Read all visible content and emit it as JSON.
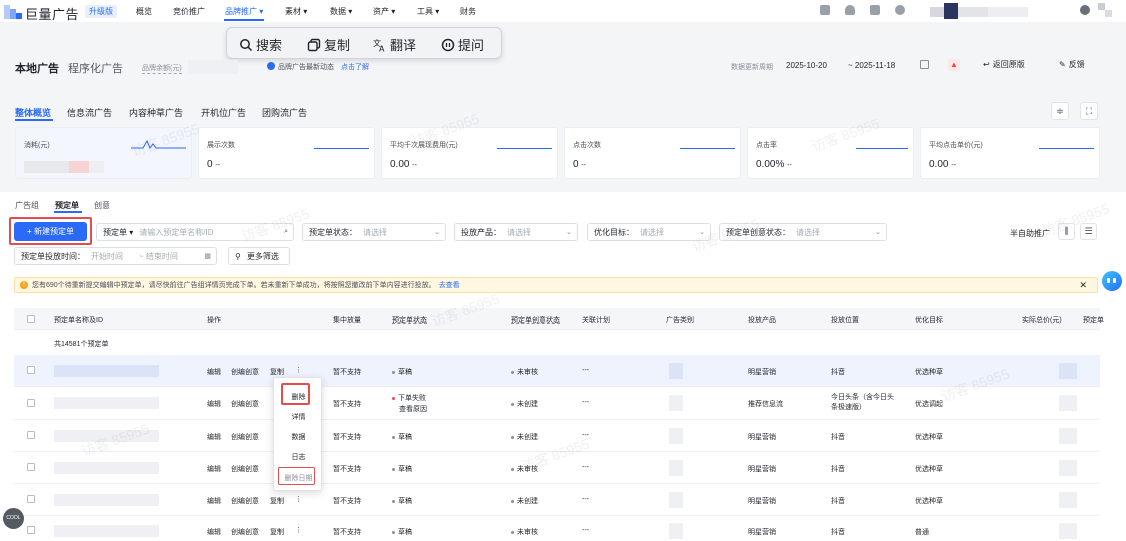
{
  "topnav": {
    "logo": "巨量广告",
    "upgrade": "升级版",
    "items": [
      "概览",
      "竞价推广",
      "品牌推广",
      "素材",
      "数据",
      "资产",
      "工具",
      "财务"
    ]
  },
  "floatbar": {
    "search": "搜索",
    "copy": "复制",
    "translate": "翻译",
    "ask": "提问"
  },
  "header": {
    "title": "本地广告",
    "subtitle": "程序化广告",
    "balance_label": "品牌余额(元)",
    "news": "品牌广告最新动态",
    "news_link": "点击了解",
    "update_label": "数据更新周期",
    "date_start": "2025-10-20",
    "date_end": "~ 2025-11-18",
    "back_label": "返回原版",
    "feedback_label": "反馈"
  },
  "tabs": [
    "整体概览",
    "信息流广告",
    "内容种草广告",
    "开机位广告",
    "团购流广告"
  ],
  "metrics": [
    {
      "label": "消耗(元)",
      "value": ""
    },
    {
      "label": "展示次数",
      "value": "0",
      "suffix": "--"
    },
    {
      "label": "平均千次展现费用(元)",
      "value": "0.00",
      "suffix": "--"
    },
    {
      "label": "点击次数",
      "value": "0",
      "suffix": "--"
    },
    {
      "label": "点击率",
      "value": "0.00%",
      "suffix": "--"
    },
    {
      "label": "平均点击单价(元)",
      "value": "0.00",
      "suffix": "--"
    }
  ],
  "subtabs": [
    "广告组",
    "预定单",
    "创意"
  ],
  "filters": {
    "new_button": "+ 新建预定单",
    "order_select": "预定单",
    "order_placeholder": "请输入预定单名称/ID",
    "status_label": "预定单状态：",
    "status_placeholder": "请选择",
    "product_label": "投放产品：",
    "product_placeholder": "请选择",
    "goal_label": "优化目标：",
    "goal_placeholder": "请选择",
    "creative_status_label": "预定单创意状态：",
    "creative_status_placeholder": "请选择",
    "semi_auto": "半自助推广",
    "time_label": "预定单投放时间：",
    "time_start": "开始时间",
    "time_end": "~ 结束时间",
    "more": "更多筛选"
  },
  "notice": {
    "text": "您有690个待重新提交编辑中预定单，请尽快前往广告组详情页完成下单。若未重新下单成功，将按照您撤改前下单内容进行投放。",
    "link": "去查看"
  },
  "table": {
    "headers": [
      "预定单名称及ID",
      "操作",
      "集中放量",
      "预定单状态",
      "预定单创意状态",
      "关联计划",
      "广告类别",
      "投放产品",
      "投放位置",
      "优化目标",
      "实际总价(元)",
      "预定单"
    ],
    "total": "共14581个预定单",
    "ops": {
      "edit": "编辑",
      "create": "创编创意",
      "copy": "复制"
    },
    "rows": [
      {
        "volume": "暂不支持",
        "status": "草稿",
        "creative": "未审核",
        "plan": "---",
        "product": "明星营销",
        "position": "抖音",
        "goal": "优选种草"
      },
      {
        "volume": "暂不支持",
        "status": "下单失败",
        "status_link": "查看原因",
        "creative": "未创建",
        "plan": "---",
        "product": "推荐信息流",
        "position": "今日头条（含今日头条极速版）",
        "goal": "优选调起"
      },
      {
        "volume": "暂不支持",
        "status": "草稿",
        "creative": "未创建",
        "plan": "---",
        "product": "明星营销",
        "position": "抖音",
        "goal": "优选种草"
      },
      {
        "volume": "暂不支持",
        "status": "草稿",
        "creative": "未审核",
        "plan": "---",
        "product": "明星营销",
        "position": "抖音",
        "goal": "优选种草"
      },
      {
        "volume": "暂不支持",
        "status": "草稿",
        "creative": "未创建",
        "plan": "---",
        "product": "明星营销",
        "position": "抖音",
        "goal": "优选种草"
      },
      {
        "volume": "暂不支持",
        "status": "草稿",
        "creative": "未审核",
        "plan": "---",
        "product": "明星营销",
        "position": "抖音",
        "goal": "普通"
      }
    ]
  },
  "menu": [
    "删除",
    "详情",
    "数据",
    "日志",
    "删除日期"
  ],
  "watermark": "访客 85955",
  "colors": {
    "accent": "#2a6af6",
    "highlight": "#e34d4d"
  }
}
